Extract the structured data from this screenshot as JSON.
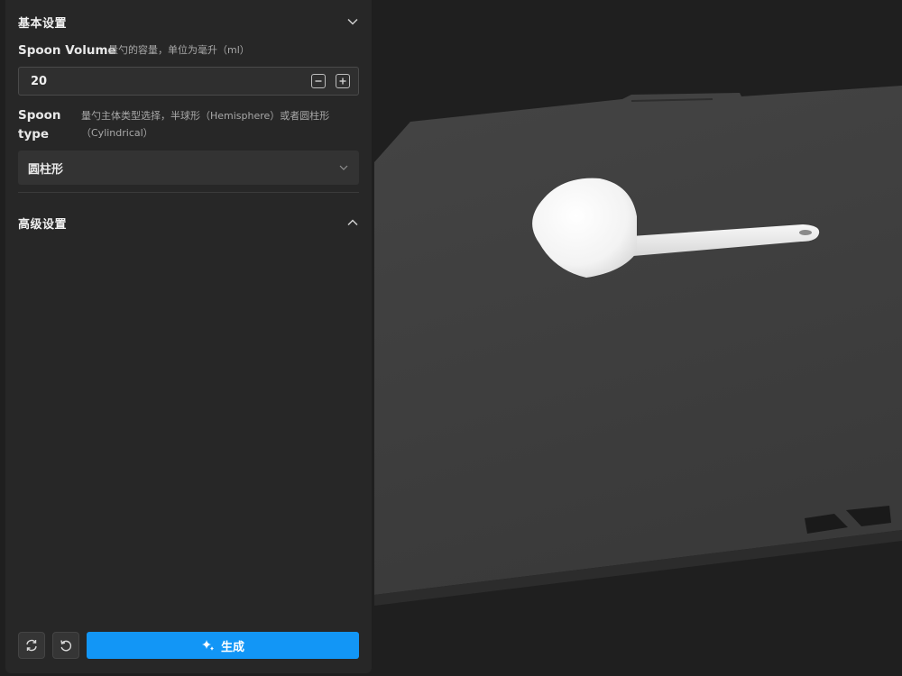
{
  "sections": {
    "basic": {
      "title": "基本设置",
      "expanded": true
    },
    "advanced": {
      "title": "高级设置",
      "expanded": true
    }
  },
  "fields": {
    "spoon_volume": {
      "label": "Spoon Volume",
      "hint": "量勺的容量，单位为毫升（ml）",
      "value": "20"
    },
    "spoon_type": {
      "label_line1": "Spoon",
      "label_line2": "type",
      "hint_line1": "量勺主体类型选择，半球形（Hemisphere）或者圆柱形",
      "hint_line2": "（Cylindrical）",
      "selected": "圆柱形"
    }
  },
  "actions": {
    "generate_label": "生成"
  },
  "icons": {
    "collapse_basic": "chevron-down-icon",
    "collapse_advanced": "chevron-up-icon",
    "decrement": "minus-icon",
    "increment": "plus-icon",
    "select": "chevron-down-icon",
    "refresh": "refresh-icon",
    "reset": "undo-icon",
    "generate": "sparkle-icon"
  },
  "colors": {
    "panel_bg": "#272727",
    "primary": "#1296f6",
    "viewport_bg": "#1f1f1f"
  }
}
